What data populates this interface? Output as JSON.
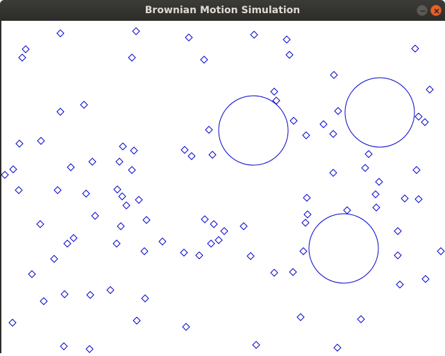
{
  "window": {
    "title": "Brownian Motion Simulation"
  },
  "colors": {
    "particle": "#0000cc",
    "background": "#ffffff",
    "titlebar": "#2d2c29",
    "close_button": "#e9622a"
  },
  "icons": {
    "minimize": "minimize-icon",
    "close": "close-icon"
  }
}
